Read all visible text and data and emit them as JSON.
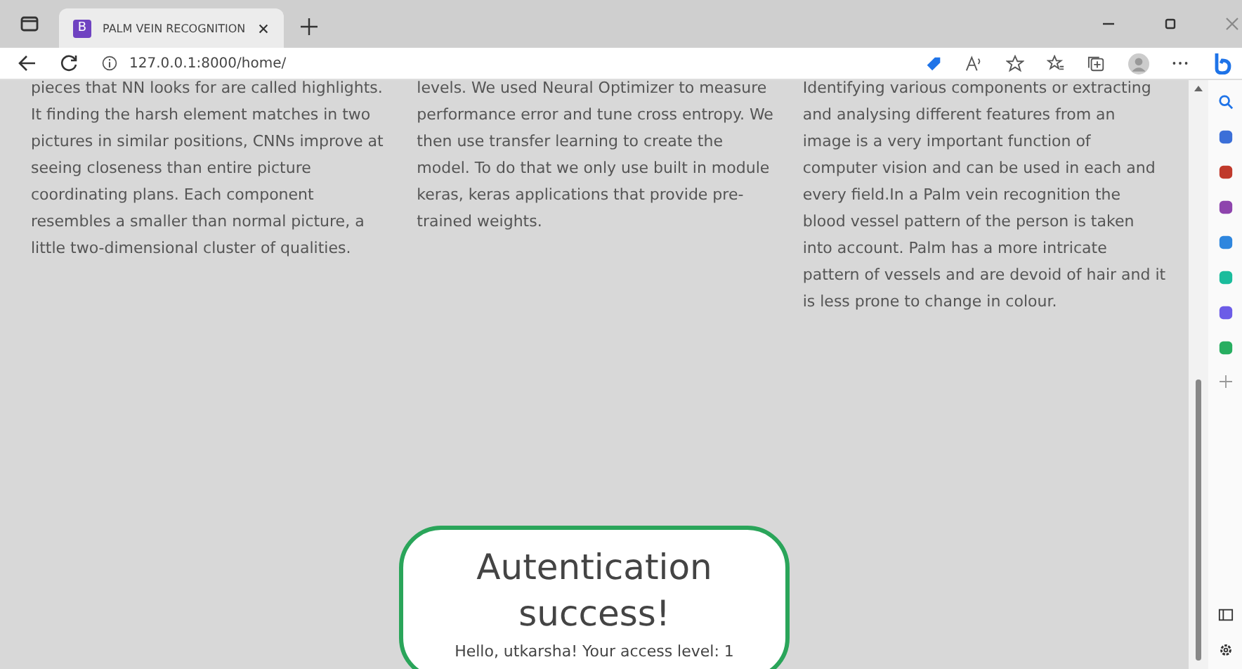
{
  "browser": {
    "tab": {
      "favicon": "B",
      "title": "PALM VEIN RECOGNITION",
      "selected": true
    },
    "url": "127.0.0.1:8000/home/"
  },
  "columns": [
    {
      "text": "pieces that NN looks for are called highlights. It finding the harsh element matches in two pictures in similar positions, CNNs improve at seeing closeness than entire picture coordinating plans. Each component resembles a smaller than normal picture, a little two-dimensional cluster of qualities."
    },
    {
      "text": "levels. We used Neural Optimizer to measure performance error and tune cross entropy. We then use transfer learning to create the model. To do that we only use built in module keras, keras applications that provide pre-trained weights."
    },
    {
      "text": "Identifying various components or extracting and analysing different features from an image is a very important function of computer vision and can be used in each and every field.In a Palm vein recognition the blood vessel pattern of the person is taken into account. Palm has a more intricate pattern of vessels and are devoid of hair and it is less prone to change in colour."
    }
  ],
  "card": {
    "title": "Autentication success!",
    "message": "Hello, utkarsha! Your access level: 1"
  }
}
